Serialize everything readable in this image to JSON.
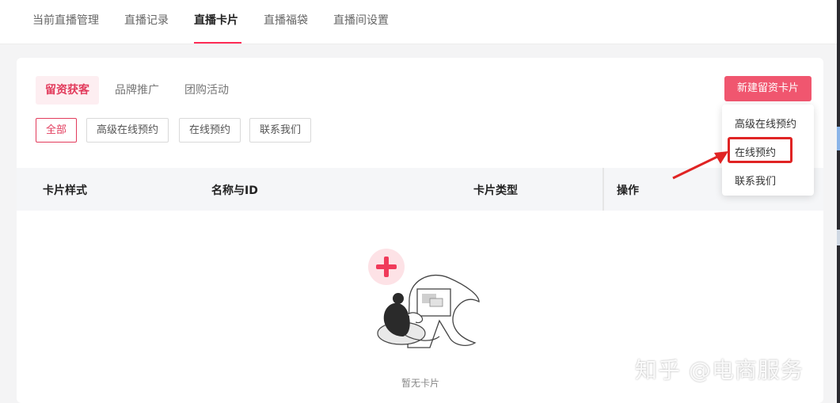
{
  "top_tabs": [
    {
      "label": "当前直播管理"
    },
    {
      "label": "直播记录"
    },
    {
      "label": "直播卡片"
    },
    {
      "label": "直播福袋"
    },
    {
      "label": "直播间设置"
    }
  ],
  "sub_tabs": [
    {
      "label": "留资获客"
    },
    {
      "label": "品牌推广"
    },
    {
      "label": "团购活动"
    }
  ],
  "filters": [
    {
      "label": "全部"
    },
    {
      "label": "高级在线预约"
    },
    {
      "label": "在线预约"
    },
    {
      "label": "联系我们"
    }
  ],
  "new_button_label": "新建留资卡片",
  "table_headers": [
    "卡片样式",
    "名称与ID",
    "卡片类型",
    "操作"
  ],
  "empty_text": "暂无卡片",
  "dropdown_items": [
    {
      "label": "高级在线预约"
    },
    {
      "label": "在线预约"
    },
    {
      "label": "联系我们"
    }
  ],
  "watermark": "知乎 @电商服务",
  "colors": {
    "accent": "#fe2c55",
    "button": "#f0566f",
    "highlight": "#e02424"
  },
  "icons": [
    "plus-icon",
    "empty-illustration"
  ]
}
